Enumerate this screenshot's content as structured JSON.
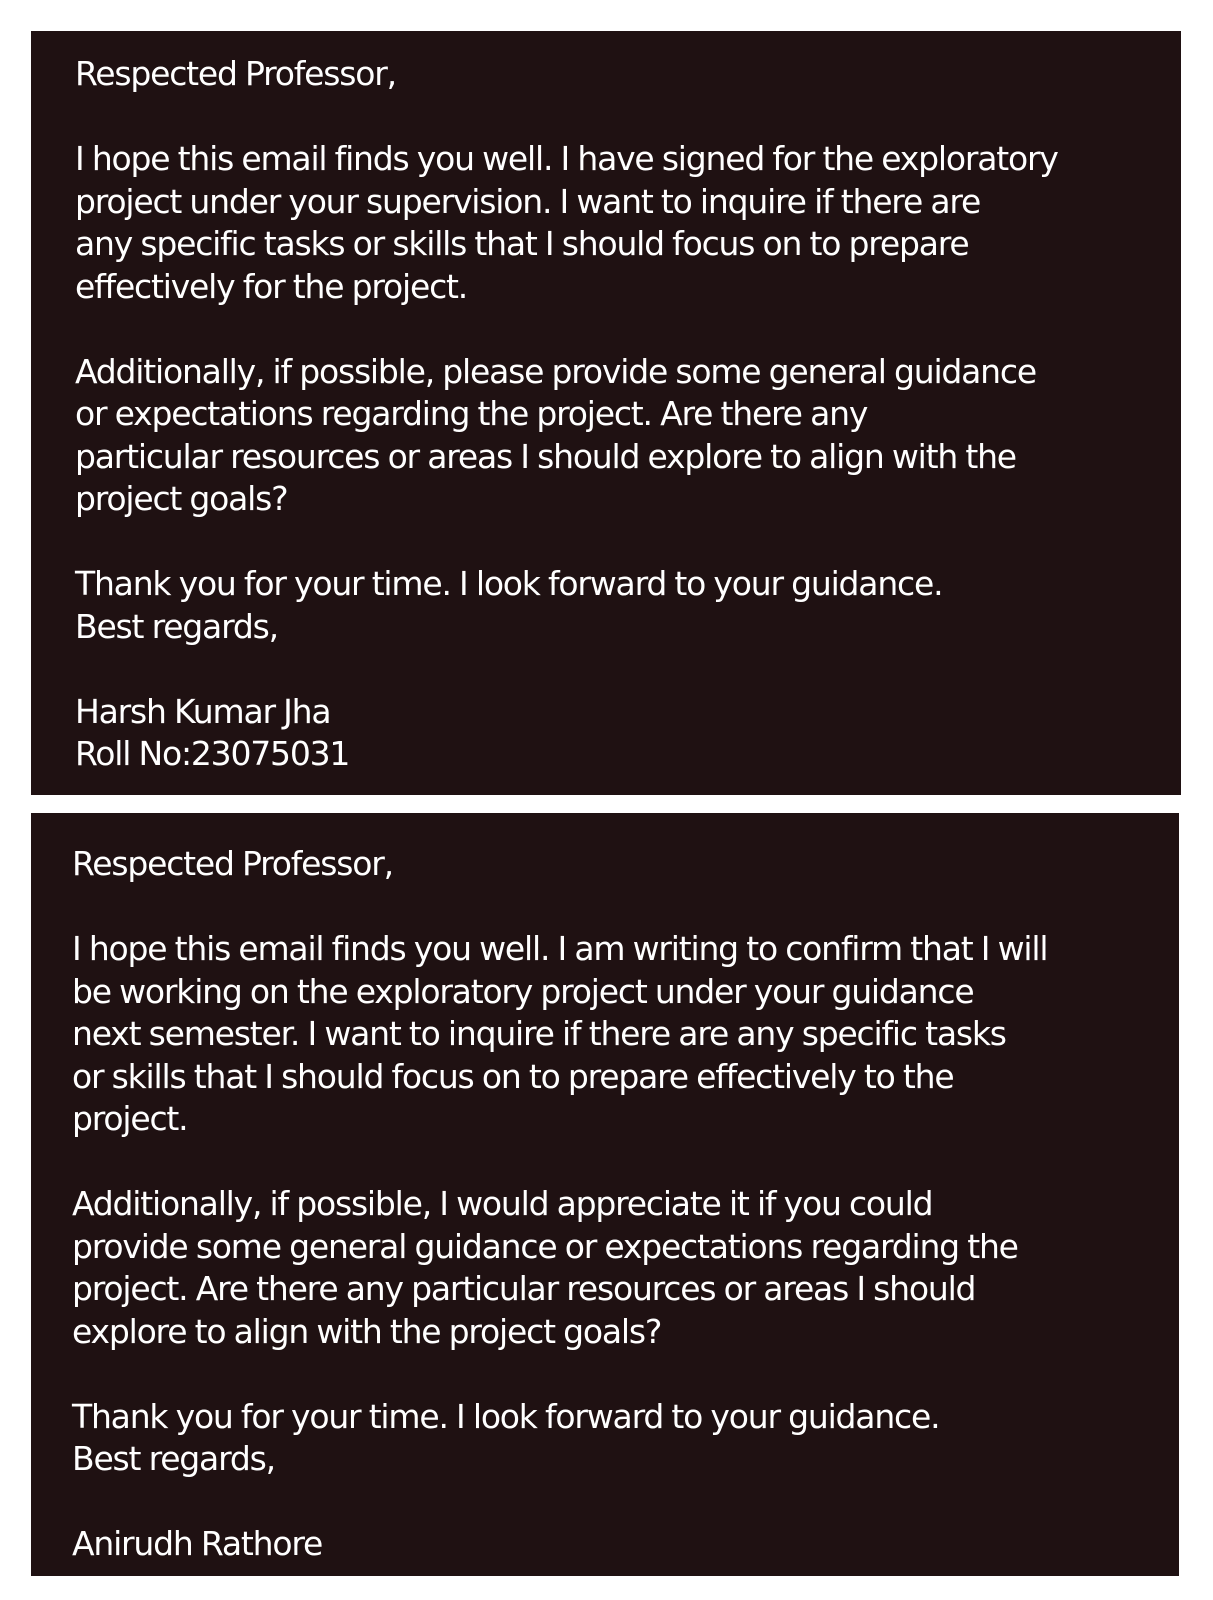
{
  "email_1": {
    "salutation": "Respected Professor,",
    "paragraph_1": [
      "I hope this email finds you well. I have signed for the exploratory",
      "project under your supervision. I want to inquire if there are",
      "any specific tasks or skills that I should focus on to prepare",
      "effectively for the project."
    ],
    "paragraph_2": [
      "Additionally, if possible, please provide some general guidance",
      "or expectations regarding the project. Are there any",
      "particular resources or areas I should explore to align with the",
      "project goals?"
    ],
    "thanks": "Thank you for your time. I look forward to your guidance.",
    "closing": "Best regards,",
    "sender_name": "Harsh Kumar Jha",
    "roll_no": "Roll No:23075031"
  },
  "email_2": {
    "salutation": "Respected Professor,",
    "paragraph_1": [
      "I hope this email finds you well. I am writing to confirm that I will",
      "be working on the exploratory project under your guidance",
      "next semester. I want to inquire if there are any specific tasks",
      "or skills that I should focus on to prepare effectively to the",
      "project."
    ],
    "paragraph_2": [
      "Additionally, if possible, I would appreciate it if you could",
      "provide some general guidance or expectations regarding the",
      "project. Are there any particular resources or areas I should",
      "explore to align with the project goals?"
    ],
    "thanks": "Thank you for your time. I look forward to your guidance.",
    "closing": "Best regards,",
    "sender_name": "Anirudh Rathore"
  }
}
